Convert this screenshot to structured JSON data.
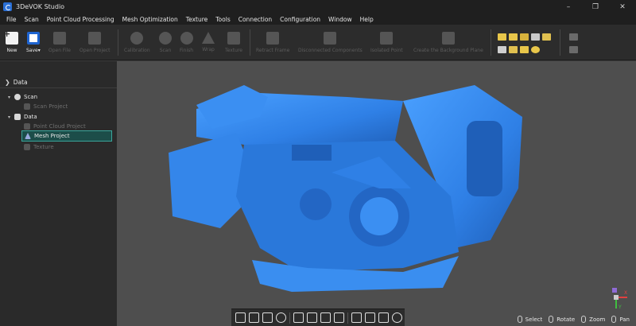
{
  "window": {
    "title": "3DeVOK Studio",
    "controls": [
      "–",
      "❐",
      "✕"
    ]
  },
  "menu": [
    "File",
    "Scan",
    "Point Cloud Processing",
    "Mesh Optimization",
    "Texture",
    "Tools",
    "Connection",
    "Configuration",
    "Window",
    "Help"
  ],
  "toolbar": {
    "new_label": "New",
    "save_label": "Save",
    "save_dropdown": "▾",
    "open_file_label": "Open File",
    "open_project_label": "Open Project",
    "calibration_label": "Calibration",
    "scan_label": "Scan",
    "finish_label": "Finish",
    "wrap_label": "Wrap",
    "texture_label": "Texture",
    "retract_frame_label": "Retract Frame",
    "disconnected_components_label": "Disconnected Components",
    "isolated_point_label": "Isolated Point",
    "create_bg_plane_label": "Create the Background Plane"
  },
  "left_panel": {
    "header": "Data",
    "tree": [
      {
        "label": "Scan",
        "level": 1,
        "active": true
      },
      {
        "label": "Scan Project",
        "level": 2,
        "active": false
      },
      {
        "label": "Data",
        "level": 1,
        "active": true
      },
      {
        "label": "Point Cloud Project",
        "level": 2,
        "active": false
      },
      {
        "label": "Mesh Project",
        "level": 2,
        "active": true,
        "selected": true
      },
      {
        "label": "Texture",
        "level": 2,
        "active": false
      }
    ]
  },
  "viewport": {
    "model_color": "#3a8ef0",
    "background": "#4e4e4e",
    "axis": {
      "x": "X",
      "y": "Y"
    },
    "hints": [
      "Select",
      "Rotate",
      "Zoom",
      "Pan"
    ]
  },
  "colors": {
    "accent": "#1e64d0",
    "selection_bg": "#1c4d49",
    "selection_border": "#3aa59b"
  }
}
